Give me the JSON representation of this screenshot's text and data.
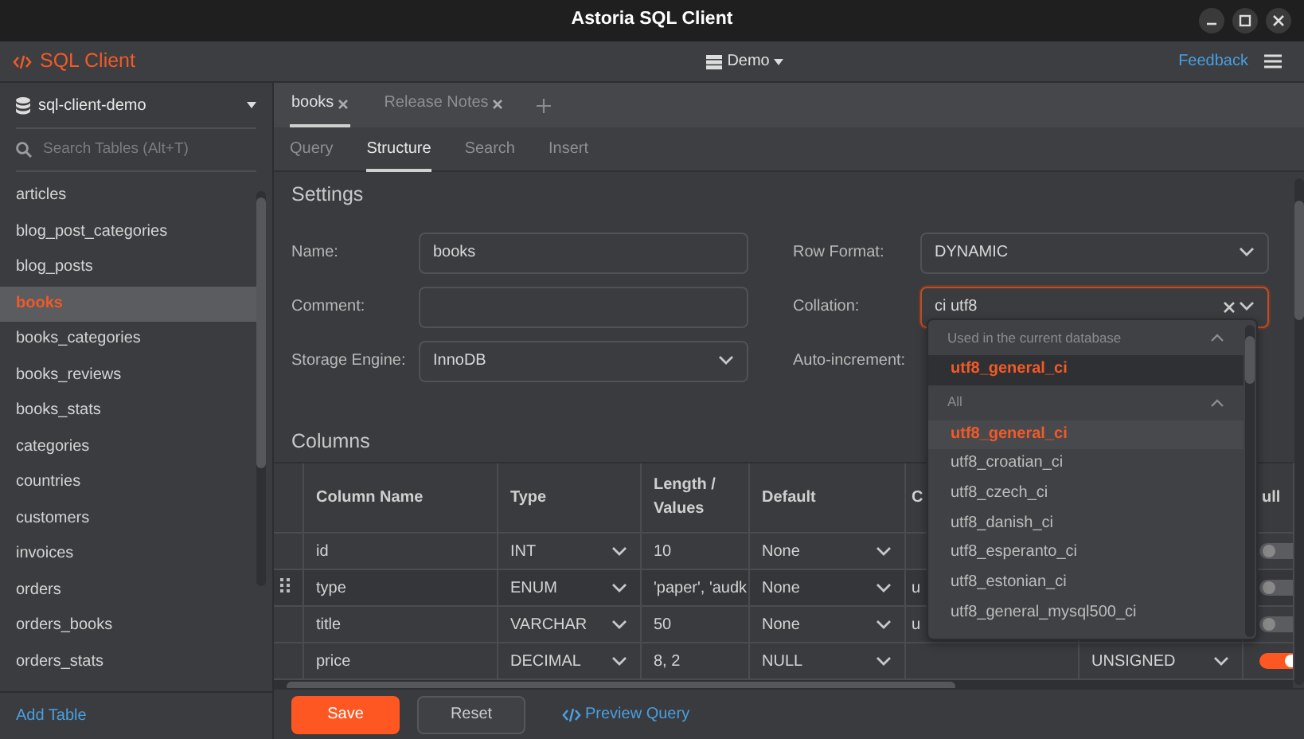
{
  "window": {
    "title": "Astoria SQL Client"
  },
  "header": {
    "app_name": "SQL Client",
    "database": "Demo",
    "feedback": "Feedback"
  },
  "sidebar": {
    "connection": "sql-client-demo",
    "search": {
      "placeholder": "Search Tables (Alt+T)"
    },
    "tables": [
      {
        "name": "articles",
        "selected": false
      },
      {
        "name": "blog_post_categories",
        "selected": false
      },
      {
        "name": "blog_posts",
        "selected": false
      },
      {
        "name": "books",
        "selected": true
      },
      {
        "name": "books_categories",
        "selected": false
      },
      {
        "name": "books_reviews",
        "selected": false
      },
      {
        "name": "books_stats",
        "selected": false
      },
      {
        "name": "categories",
        "selected": false
      },
      {
        "name": "countries",
        "selected": false
      },
      {
        "name": "customers",
        "selected": false
      },
      {
        "name": "invoices",
        "selected": false
      },
      {
        "name": "orders",
        "selected": false
      },
      {
        "name": "orders_books",
        "selected": false
      },
      {
        "name": "orders_stats",
        "selected": false
      }
    ],
    "add_table": "Add Table"
  },
  "tabs": [
    {
      "label": "books",
      "selected": true
    },
    {
      "label": "Release Notes",
      "selected": false
    }
  ],
  "subtabs": [
    {
      "label": "Query",
      "selected": false
    },
    {
      "label": "Structure",
      "selected": true
    },
    {
      "label": "Search",
      "selected": false
    },
    {
      "label": "Insert",
      "selected": false
    }
  ],
  "settings": {
    "title": "Settings",
    "fields": [
      {
        "label": "Name:",
        "kind": "input",
        "value": "books"
      },
      {
        "label": "Row Format:",
        "kind": "select",
        "value": "DYNAMIC"
      },
      {
        "label": "Comment:",
        "kind": "input"
      },
      {
        "label": "Collation:",
        "kind": "combo",
        "value": "ci utf8",
        "focused": true
      },
      {
        "label": "Storage Engine:",
        "kind": "select",
        "value": "InnoDB"
      },
      {
        "label": "Auto-increment:",
        "kind": "label"
      }
    ]
  },
  "collation_dropdown": {
    "groups": [
      {
        "title": "Used in the current database",
        "expanded": true,
        "options": [
          {
            "label": "utf8_general_ci",
            "selected": true
          }
        ]
      },
      {
        "title": "All",
        "expanded": true,
        "options": [
          {
            "label": "utf8_general_ci",
            "selected": true
          },
          {
            "label": "utf8_croatian_ci",
            "selected": false
          },
          {
            "label": "utf8_czech_ci",
            "selected": false
          },
          {
            "label": "utf8_danish_ci",
            "selected": false
          },
          {
            "label": "utf8_esperanto_ci",
            "selected": false
          },
          {
            "label": "utf8_estonian_ci",
            "selected": false
          },
          {
            "label": "utf8_general_mysql500_ci",
            "selected": false
          }
        ]
      }
    ]
  },
  "columns": {
    "title": "Columns",
    "headers": {
      "name": "Column Name",
      "type": "Type",
      "length": "Length / Values",
      "default": "Default",
      "column_5": "C",
      "column_7": "ull"
    },
    "rows": [
      {
        "name": "id",
        "type": "INT",
        "length": "10",
        "default": "None",
        "null": false,
        "hovered": false
      },
      {
        "name": "type",
        "type": "ENUM",
        "length": "'paper', 'audk",
        "default": "None",
        "column_5": "u",
        "null": false,
        "hovered": true
      },
      {
        "name": "title",
        "type": "VARCHAR",
        "length": "50",
        "default": "None",
        "column_5": "u",
        "null": false,
        "hovered": false
      },
      {
        "name": "price",
        "type": "DECIMAL",
        "length": "8, 2",
        "default": "NULL",
        "column_6": "UNSIGNED",
        "null": true,
        "hovered": false
      }
    ]
  },
  "actions": {
    "save": "Save",
    "reset": "Reset",
    "preview": "Preview Query"
  }
}
